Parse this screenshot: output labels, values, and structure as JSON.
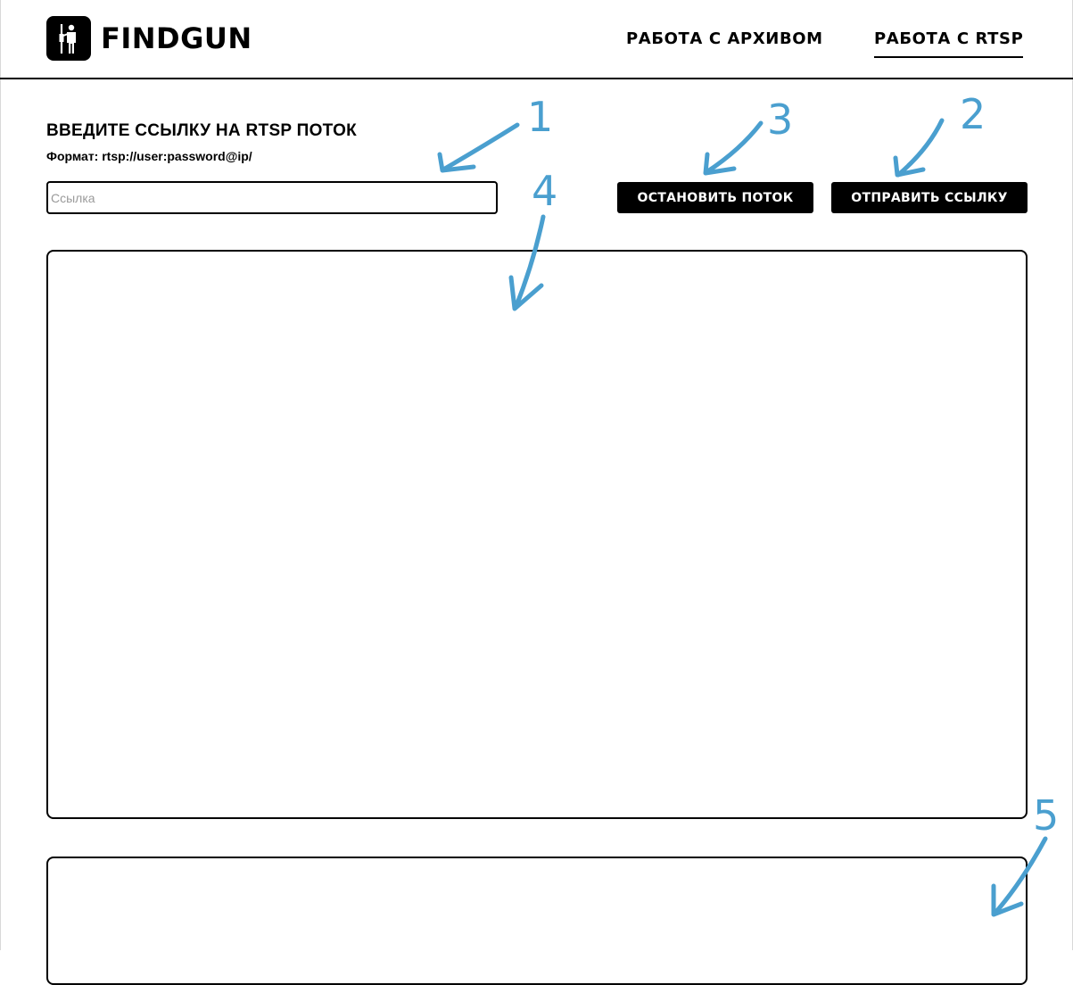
{
  "app": {
    "name": "FINDGUN",
    "logo_icon": "soldier-with-rifle-icon"
  },
  "nav": {
    "items": [
      {
        "label": "РАБОТА С АРХИВОМ",
        "active": false
      },
      {
        "label": "РАБОТА С RTSP",
        "active": true
      }
    ]
  },
  "form": {
    "title": "ВВЕДИТЕ ССЫЛКУ НА RTSP ПОТОК",
    "format_hint": "Формат: rtsp://user:password@ip/",
    "url_value": "",
    "url_placeholder": "Ссылка",
    "stop_label": "ОСТАНОВИТЬ ПОТОК",
    "send_label": "ОТПРАВИТЬ ССЫЛКУ"
  },
  "annotations": {
    "color": "#4a9fcf",
    "labels": [
      "1",
      "2",
      "3",
      "4",
      "5"
    ]
  }
}
